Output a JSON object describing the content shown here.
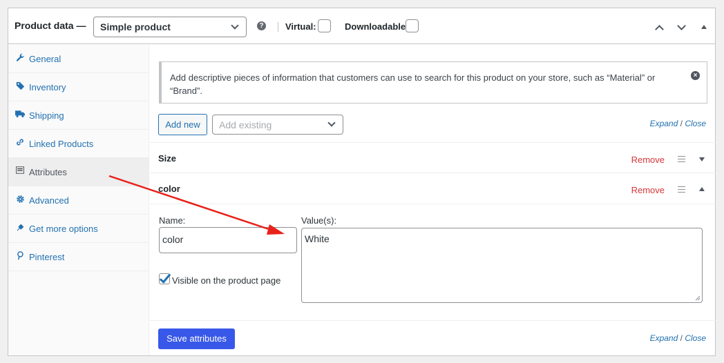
{
  "header": {
    "title": "Product data —",
    "product_type": "Simple product",
    "help_glyph": "?",
    "virtual_label": "Virtual:",
    "downloadable_label": "Downloadable:"
  },
  "sidebar": {
    "items": [
      {
        "label": "General",
        "icon": "wrench-icon"
      },
      {
        "label": "Inventory",
        "icon": "tag-icon"
      },
      {
        "label": "Shipping",
        "icon": "truck-icon"
      },
      {
        "label": "Linked Products",
        "icon": "link-icon"
      },
      {
        "label": "Attributes",
        "icon": "list-view-icon",
        "active": true
      },
      {
        "label": "Advanced",
        "icon": "gear-icon"
      },
      {
        "label": "Get more options",
        "icon": "plugin-icon"
      },
      {
        "label": "Pinterest",
        "icon": "pinterest-icon"
      }
    ]
  },
  "notice": {
    "text": "Add descriptive pieces of information that customers can use to search for this product on your store, such as “Material” or “Brand”.",
    "close_glyph": "×"
  },
  "toolbar": {
    "add_new": "Add new",
    "add_existing_placeholder": "Add existing",
    "expand": "Expand",
    "slash": "/",
    "close": "Close"
  },
  "attributes": [
    {
      "name": "Size",
      "remove": "Remove",
      "expanded": false
    },
    {
      "name": "color",
      "remove": "Remove",
      "expanded": true
    }
  ],
  "editor": {
    "name_label": "Name:",
    "name_value": "color",
    "values_label": "Value(s):",
    "values_value": "White",
    "visible_label": "Visible on the product page",
    "visible_checked": true
  },
  "footer": {
    "save": "Save attributes",
    "expand": "Expand",
    "slash": "/",
    "close": "Close"
  },
  "colors": {
    "primary": "#3858e9",
    "link": "#2271b1",
    "danger": "#d63638",
    "annotation_arrow": "#e8221b"
  }
}
